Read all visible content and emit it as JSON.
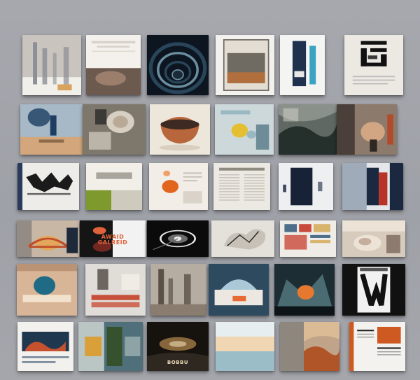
{
  "wall": {
    "labels": {
      "b1": "",
      "s4": "",
      "d2": "AWAID\nGALREID",
      "a5": "",
      "f3": "BOBBU"
    },
    "cards": [
      {
        "id": "a1",
        "name": "card-city-towers",
        "shape": "towers",
        "bg": "#c9c4bd",
        "colors": [
          "#8c8f97",
          "#d8a35c",
          "#f1efe9"
        ]
      },
      {
        "id": "a2",
        "name": "card-text-hand",
        "shape": "textblock",
        "bg": "#f4f1ec",
        "colors": [
          "#d8d2c8",
          "#9b7e6b",
          "#6d5a4e"
        ]
      },
      {
        "id": "a3",
        "name": "card-spiral-tunnel",
        "shape": "spiral",
        "bg": "#0d1620",
        "colors": [
          "#28455a",
          "#6b8ea0",
          "#1a2a36"
        ]
      },
      {
        "id": "a4",
        "name": "card-framed-photo",
        "shape": "frame",
        "bg": "#f3f1ee",
        "colors": [
          "#6f6b63",
          "#b06f3c",
          "#e3ddd3"
        ]
      },
      {
        "id": "a5",
        "name": "card-blue-panels",
        "shape": "panels",
        "bg": "#f4f4f2",
        "colors": [
          "#20314e",
          "#3aa3c1",
          "#e6e6e6"
        ]
      },
      {
        "id": "a6",
        "name": "card-glyph-poster",
        "shape": "glyph",
        "bg": "#ece9e3",
        "colors": [
          "#111111",
          "#3a3a3a",
          "#bbbbbb"
        ]
      },
      {
        "id": "b1",
        "name": "card-orbiting-figure",
        "shape": "sphere",
        "bg": "#a7b8c6",
        "colors": [
          "#d3a77b",
          "#1d3e62",
          "#8c6a4a"
        ]
      },
      {
        "id": "b2",
        "name": "card-sketch-collage",
        "shape": "collage",
        "bg": "#7d776c",
        "colors": [
          "#d6cfc2",
          "#3b3a37",
          "#b8aa96"
        ]
      },
      {
        "id": "b3",
        "name": "card-bowl-still-life",
        "shape": "bowl",
        "bg": "#ede6da",
        "colors": [
          "#b8673c",
          "#3d2a22",
          "#d9cfc0"
        ]
      },
      {
        "id": "b4",
        "name": "card-yellow-blob",
        "shape": "blob",
        "bg": "#cdd8da",
        "colors": [
          "#e5bf32",
          "#9ab8c2",
          "#2d5a6b"
        ]
      },
      {
        "id": "b5",
        "name": "card-ink-wash",
        "shape": "wash",
        "bg": "#5f6863",
        "colors": [
          "#a6ada6",
          "#25302c",
          "#d6d6cc"
        ]
      },
      {
        "id": "b6",
        "name": "card-sepia-montage",
        "shape": "montage",
        "bg": "#8c7b6c",
        "colors": [
          "#2f2723",
          "#d2a682",
          "#b24a2c"
        ]
      },
      {
        "id": "c1",
        "name": "card-typography-wordmark",
        "shape": "graffiti",
        "bg": "#eeece8",
        "colors": [
          "#1b1b1b",
          "#6a6a6a",
          "#2a3a5b"
        ]
      },
      {
        "id": "c2",
        "name": "card-green-strip",
        "shape": "greenstrip",
        "bg": "#f2efe8",
        "colors": [
          "#7e9a2d",
          "#5f5a50",
          "#cfcabe"
        ]
      },
      {
        "id": "c3",
        "name": "card-orange-dots",
        "shape": "dots",
        "bg": "#f2ede6",
        "colors": [
          "#e2651f",
          "#f0a06a",
          "#c8c2b8"
        ]
      },
      {
        "id": "c4",
        "name": "card-article-layout",
        "shape": "article",
        "bg": "#ece8e2",
        "colors": [
          "#c4bfb6",
          "#8f8a80",
          "#dedad4"
        ]
      },
      {
        "id": "c5",
        "name": "card-navy-box",
        "shape": "navybox",
        "bg": "#eeeff1",
        "colors": [
          "#172236",
          "#6d7687",
          "#3c4b63"
        ]
      },
      {
        "id": "c6",
        "name": "card-red-panels",
        "shape": "redpanels",
        "bg": "#e4e6e9",
        "colors": [
          "#1a2840",
          "#b83226",
          "#5a6f88"
        ]
      },
      {
        "id": "d1",
        "name": "card-sunset-bridge",
        "shape": "bridge",
        "bg": "#c8b7a4",
        "colors": [
          "#c04a26",
          "#1e2a3a",
          "#e2a75d"
        ]
      },
      {
        "id": "d2",
        "name": "card-award-title",
        "shape": "award",
        "bg": "#151515",
        "colors": [
          "#e0623b",
          "#f2f2f2",
          "#b0362a"
        ]
      },
      {
        "id": "d3",
        "name": "card-dark-swirl",
        "shape": "swirl",
        "bg": "#0b0b0b",
        "colors": [
          "#e8e8e8",
          "#6b6b6b",
          "#2a2a2a"
        ]
      },
      {
        "id": "d4",
        "name": "card-bird-sketch",
        "shape": "sketch",
        "bg": "#e4e0da",
        "colors": [
          "#2b2b2b",
          "#8d8880",
          "#c7c1b8"
        ]
      },
      {
        "id": "d5",
        "name": "card-swatch-grid",
        "shape": "swatches",
        "bg": "#efece7",
        "colors": [
          "#c94a3a",
          "#4e6e8a",
          "#d8b36b"
        ]
      },
      {
        "id": "d6",
        "name": "card-floral-room",
        "shape": "floral",
        "bg": "#d7cbbd",
        "colors": [
          "#9b7b61",
          "#ece3d6",
          "#5a4638"
        ]
      },
      {
        "id": "e1",
        "name": "card-planet-cutout",
        "shape": "planet",
        "bg": "#d9b597",
        "colors": [
          "#1f6a85",
          "#f1e2cd",
          "#8d5e40"
        ]
      },
      {
        "id": "e2",
        "name": "card-fountain-pipes",
        "shape": "pipes",
        "bg": "#e0ddd8",
        "colors": [
          "#c7503a",
          "#6d6660",
          "#f0ebe4"
        ]
      },
      {
        "id": "e3",
        "name": "card-mist-city",
        "shape": "mistcity",
        "bg": "#b5aca2",
        "colors": [
          "#5c5147",
          "#d7cec4",
          "#8a7c6f"
        ]
      },
      {
        "id": "e4",
        "name": "card-dome-city",
        "shape": "dome",
        "bg": "#2e4a5f",
        "colors": [
          "#a9c8d8",
          "#e76a33",
          "#ece7e0"
        ]
      },
      {
        "id": "e5",
        "name": "card-orange-orb",
        "shape": "orb",
        "bg": "#1d2d34",
        "colors": [
          "#e6792f",
          "#4b6b72",
          "#0d1519"
        ]
      },
      {
        "id": "e6",
        "name": "card-letter-poster",
        "shape": "letter",
        "bg": "#111111",
        "colors": [
          "#f1f1f1",
          "#555555",
          "#999999"
        ]
      },
      {
        "id": "f1",
        "name": "card-coral-map",
        "shape": "coralmap",
        "bg": "#f3f1ed",
        "colors": [
          "#1f3850",
          "#c6512e",
          "#7e8ea0"
        ]
      },
      {
        "id": "f2",
        "name": "card-color-blocks",
        "shape": "blocks",
        "bg": "#4f6f7a",
        "colors": [
          "#d9a03a",
          "#35512d",
          "#b9c6c3"
        ]
      },
      {
        "id": "f3",
        "name": "card-dark-landscape",
        "shape": "darkland",
        "bg": "#16130f",
        "colors": [
          "#b98a4e",
          "#ecdcb8",
          "#2f2820"
        ]
      },
      {
        "id": "f4",
        "name": "card-sky-gradient",
        "shape": "sky",
        "bg": "#cfdadf",
        "colors": [
          "#f0d6b3",
          "#84b0bd",
          "#e6eef0"
        ]
      },
      {
        "id": "f5",
        "name": "card-copper-waves",
        "shape": "waves",
        "bg": "#bfa48a",
        "colors": [
          "#b05527",
          "#e6c49a",
          "#5b6a72"
        ]
      },
      {
        "id": "f6",
        "name": "card-book-spread",
        "shape": "spread",
        "bg": "#f4f2ef",
        "colors": [
          "#ce5a22",
          "#222222",
          "#9a9a9a"
        ]
      }
    ]
  }
}
